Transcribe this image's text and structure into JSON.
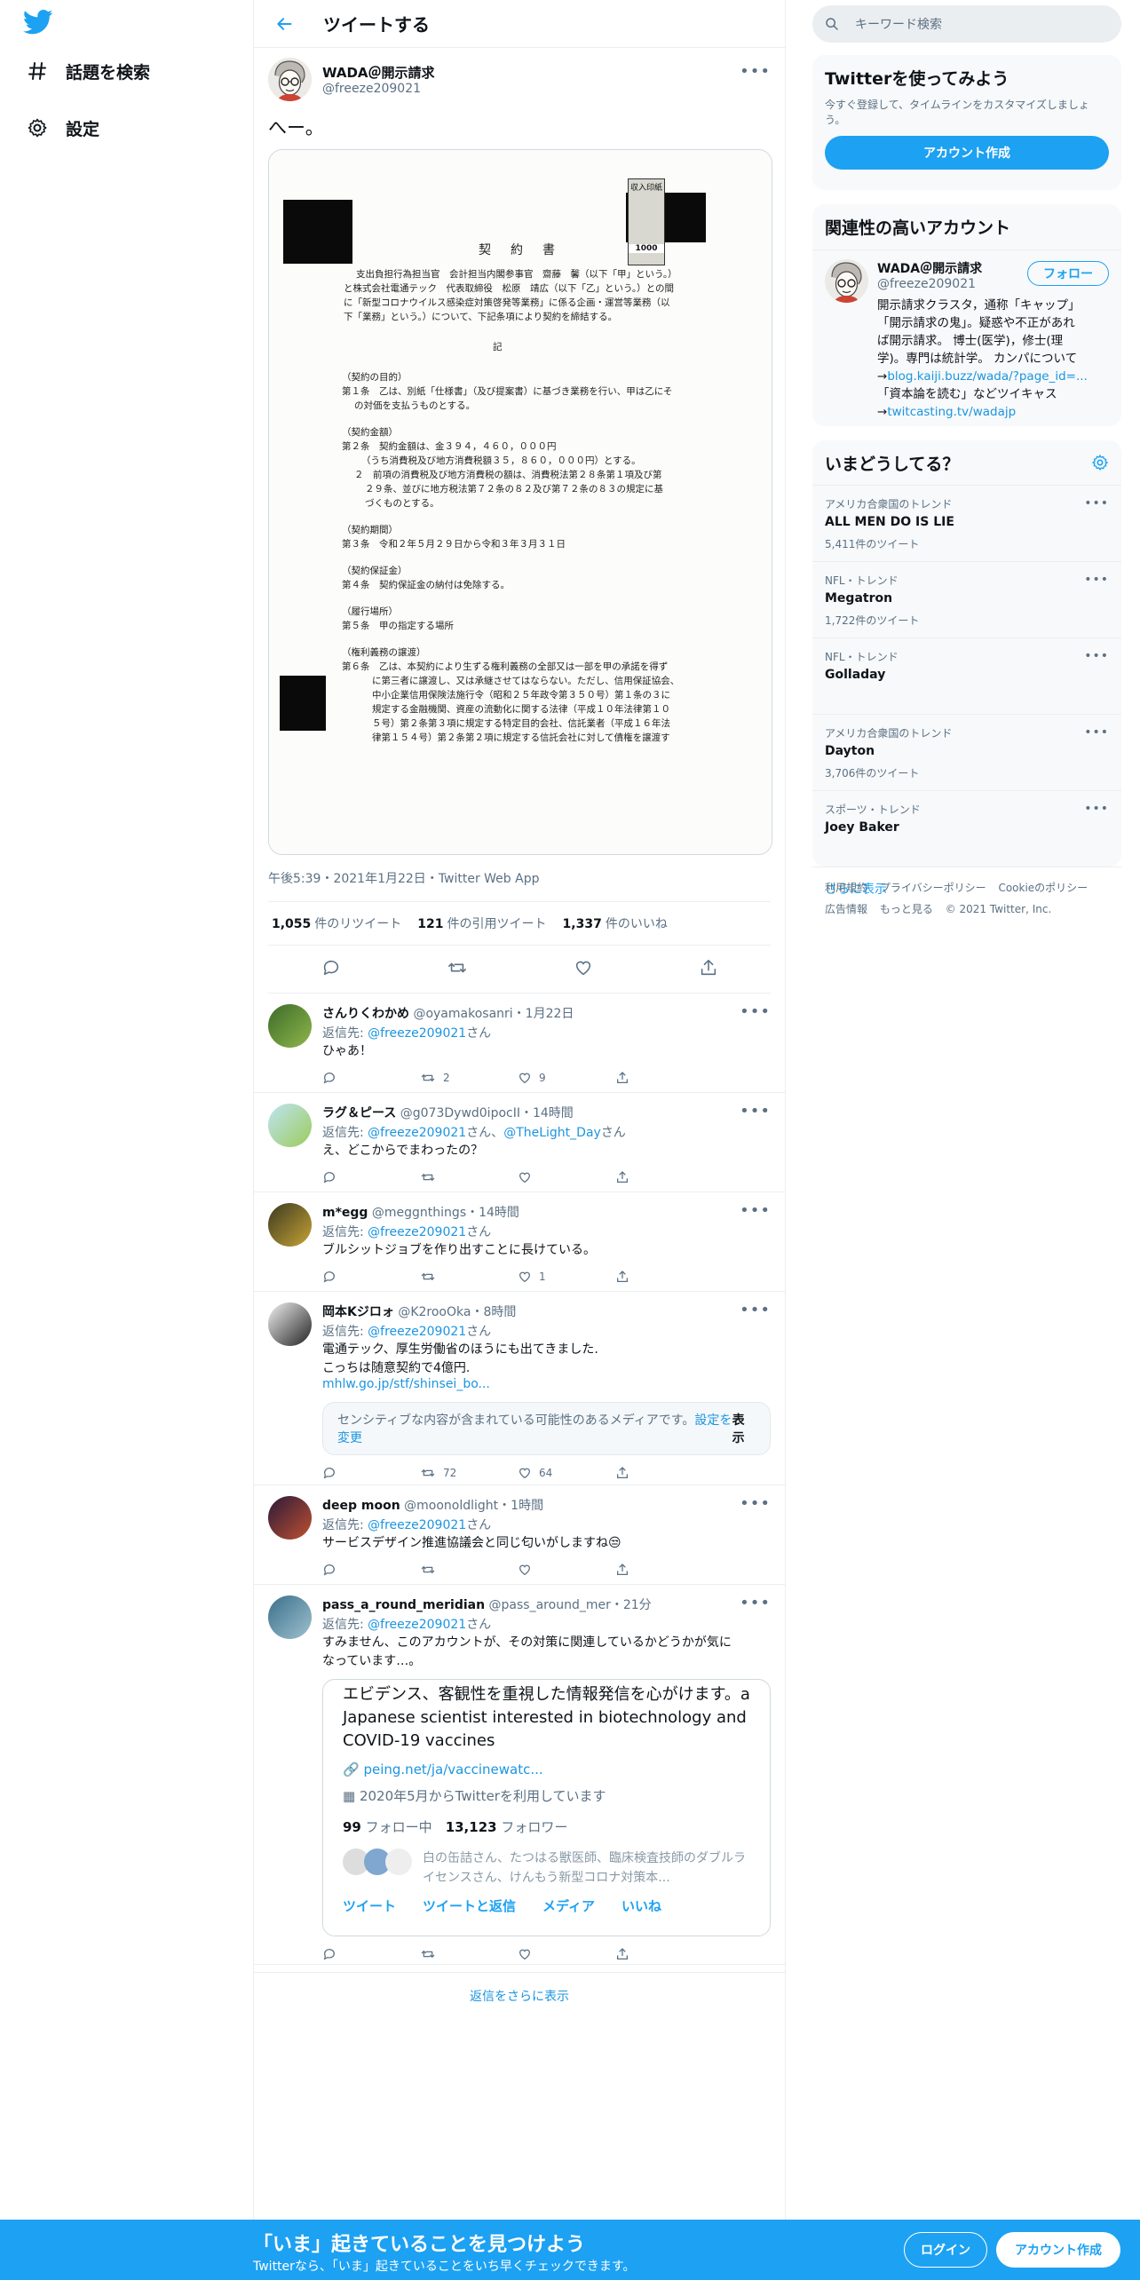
{
  "nav": {
    "logo": "twitter-bird-icon",
    "explore_label": "話題を検索",
    "settings_label": "設定"
  },
  "header": {
    "title": "ツイートする"
  },
  "tweet": {
    "name": "WADA＠開示請求",
    "handle": "@freeze209021",
    "text": "へー。",
    "timestamp": "午後5:39・2021年1月22日・Twitter Web App",
    "retweets": "1,055",
    "retweets_label": "件のリツイート",
    "quotes": "121",
    "quotes_label": "件の引用ツイート",
    "likes": "1,337",
    "likes_label": "件のいいね",
    "image": {
      "title": "契　約　書",
      "stamp": "収入印紙",
      "stamp_value": "1000",
      "lines": [
        "支出負担行為担当官　会計担当内閣参事官　齋藤　馨（以下「甲」という。）",
        "と株式会社電通テック　代表取締役　松原　靖広（以下「乙」という。）との間",
        "に「新型コロナウイルス感染症対策啓発等業務」に係る企画・運営等業務（以",
        "下「業務」という。）について、下記条項により契約を締結する。",
        "記",
        "（契約の目的）",
        "第１条　乙は、別紙「仕様書」（及び提案書）に基づき業務を行い、甲は乙にそ",
        "の対価を支払うものとする。",
        "（契約金額）",
        "第２条　契約金額は、金３９４，４６０，０００円",
        "（うち消費税及び地方消費税額３５，８６０，０００円）とする。",
        "２　前項の消費税及び地方消費税の額は、消費税法第２８条第１項及び第",
        "２９条、並びに地方税法第７２条の８２及び第７２条の８３の規定に基",
        "づくものとする。",
        "（契約期間）",
        "第３条　令和２年５月２９日から令和３年３月３１日",
        "（契約保証金）",
        "第４条　契約保証金の納付は免除する。",
        "（履行場所）",
        "第５条　甲の指定する場所",
        "（権利義務の譲渡）",
        "第６条　乙は、本契約により生ずる権利義務の全部又は一部を甲の承諾を得ず",
        "に第三者に譲渡し、又は承継させてはならない。ただし、信用保証協会、",
        "中小企業信用保険法施行令（昭和２５年政令第３５０号）第１条の３に",
        "規定する金融機関、資産の流動化に関する法律（平成１０年法律第１０",
        "５号）第２条第３項に規定する特定目的会社、信託業者（平成１６年法",
        "律第１５４号）第２条第２項に規定する信託会社に対して債権を譲渡す"
      ]
    }
  },
  "replies": [
    {
      "name": "さんりくわかめ",
      "handle": "@oyamakosanri",
      "time": "・1月22日",
      "to_prefix": "返信先: ",
      "to": "@freeze209021",
      "to_suffix": "さん",
      "text": "ひゃあ！",
      "rt": "2",
      "like": "9"
    },
    {
      "name": "ラグ＆ピース",
      "handle": "@g073Dywd0ipocII",
      "time": "・14時間",
      "to_prefix": "返信先: ",
      "to": "@freeze209021",
      "to_mid": "さん、",
      "to2": "@TheLight_Day",
      "to_suffix": "さん",
      "text": "え、どこからでまわったの？",
      "rt": "",
      "like": ""
    },
    {
      "name": "m*egg",
      "handle": "@meggnthings",
      "time": "・14時間",
      "to_prefix": "返信先: ",
      "to": "@freeze209021",
      "to_suffix": "さん",
      "text": "ブルシットジョブを作り出すことに長けている。",
      "rt": "",
      "like": "1"
    },
    {
      "name": "岡本Kジロォ",
      "handle": "@K2rooOka",
      "time": "・8時間",
      "to_prefix": "返信先: ",
      "to": "@freeze209021",
      "to_suffix": "さん",
      "text": "電通テック、厚生労働省のほうにも出てきました.",
      "text2": "こっちは随意契約で4億円.",
      "link": "mhlw.go.jp/stf/shinsei_bo...",
      "sensitive": "センシティブな内容が含まれている可能性のあるメディアです。",
      "sensitive_link": "設定を変更",
      "show": "表示",
      "rt": "72",
      "like": "64"
    },
    {
      "name": "deep moon",
      "handle": "@moonoldlight",
      "time": "・1時間",
      "to_prefix": "返信先: ",
      "to": "@freeze209021",
      "to_suffix": "さん",
      "text": "サービスデザイン推進協議会と同じ匂いがしますね😒",
      "rt": "",
      "like": ""
    },
    {
      "name": "pass_a_round_meridian",
      "handle": "@pass_around_mer",
      "time": "・21分",
      "to_prefix": "返信先: ",
      "to": "@freeze209021",
      "to_suffix": "さん",
      "text": "すみません、このアカウントが、その対策に関連しているかどうかが気に",
      "text2": "なっています…。",
      "rt": "",
      "like": ""
    }
  ],
  "card": {
    "bio": "エビデンス、客観性を重視した情報発信を心がけます。a Japanese scientist interested in biotechnology and COVID-19 vaccines",
    "link": "peing.net/ja/vaccinewatc...",
    "joined": "2020年5月からTwitterを利用しています",
    "following": "99",
    "following_label": "フォロー中",
    "followers": "13,123",
    "followers_label": "フォロワー",
    "followed_by": "白の缶詰さん、たつはる獣医師、臨床検査技師のダブルライセンスさん、けんもう新型コロナ対策本...",
    "tabs": "ツイート　　ツイートと返信　　メディア　　いいね"
  },
  "show_more_replies": "返信をさらに表示",
  "right": {
    "search_placeholder": "キーワード検索",
    "signup_title": "Twitterを使ってみよう",
    "signup_sub": "今すぐ登録して、タイムラインをカスタマイズしましょう。",
    "signup_button": "アカウント作成",
    "related_title": "関連性の高いアカウント",
    "related_name": "WADA＠開示請求",
    "related_handle": "@freeze209021",
    "follow_button": "フォロー",
    "related_bio_1": "開示請求クラスタ，通称「キャップ」",
    "related_bio_2": "「開示請求の鬼」。疑惑や不正があれ",
    "related_bio_3": "ば開示請求。 博士(医学)，修士(理",
    "related_bio_4": "学)。専門は統計学。 カンパについて",
    "related_link1": "blog.kaiji.buzz/wada/?page_id=...",
    "related_bio_5": "「資本論を読む」などツイキャス",
    "related_link2": "twitcasting.tv/wadajp",
    "trends_title": "いまどうしてる？",
    "trends": [
      {
        "context": "アメリカ合衆国のトレンド",
        "title": "ALL MEN DO IS LIE",
        "count": "5,411件のツイート"
      },
      {
        "context": "NFL・トレンド",
        "title": "Megatron",
        "count": "1,722件のツイート"
      },
      {
        "context": "NFL・トレンド",
        "title": "Golladay",
        "count": ""
      },
      {
        "context": "アメリカ合衆国のトレンド",
        "title": "Dayton",
        "count": "3,706件のツイート"
      },
      {
        "context": "スポーツ・トレンド",
        "title": "Joey Baker",
        "count": ""
      }
    ],
    "trends_more": "さらに表示",
    "footer_links": [
      "利用規約",
      "プライバシーポリシー",
      "Cookieのポリシー",
      "広告情報",
      "もっと見る"
    ],
    "copyright": "© 2021 Twitter, Inc."
  },
  "banner": {
    "title": "「いま」起きていることを見つけよう",
    "subtitle": "Twitterなら、「いま」起きていることをいち早くチェックできます。",
    "login": "ログイン",
    "signup": "アカウント作成"
  },
  "colors": {
    "accent": "#1da1f2",
    "link": "#1b95e0",
    "muted": "#5b7083"
  }
}
